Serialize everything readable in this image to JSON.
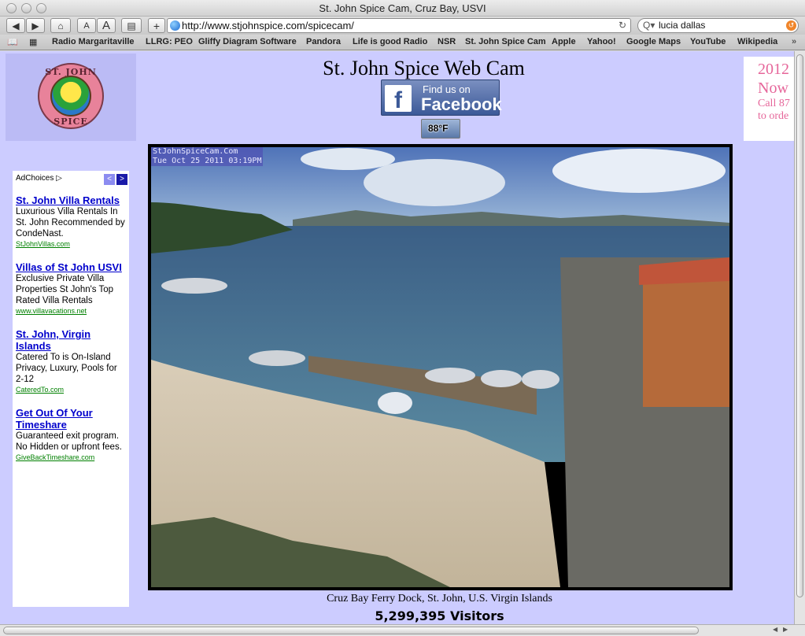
{
  "window": {
    "title": "St. John Spice Cam, Cruz Bay, USVI"
  },
  "toolbar": {
    "back_icon": "back-arrow-icon",
    "forward_icon": "forward-arrow-icon",
    "home_icon": "home-icon",
    "text_smaller": "A",
    "text_bigger": "A",
    "print_icon": "print-icon",
    "add_icon": "+",
    "url": "http://www.stjohnspice.com/spicecam/",
    "reload_glyph": "↻",
    "search_value": "lucia dallas",
    "search_glyph": "Q▾"
  },
  "bookmarks": {
    "book_icon": "📖",
    "grid_icon": "▦",
    "items": [
      "Radio Margaritaville",
      "LLRG: PEO",
      "Gliffy Diagram Software",
      "Pandora",
      "Life is good Radio",
      "NSR",
      "St. John Spice Cam",
      "Apple",
      "Yahoo!",
      "Google Maps",
      "YouTube",
      "Wikipedia"
    ],
    "overflow": "»"
  },
  "logo": {
    "top": "ST. JOHN",
    "bottom": "SPICE"
  },
  "page": {
    "title": "St. John Spice Web Cam",
    "facebook": {
      "small": "Find us on",
      "big": "Facebook",
      "f": "f"
    },
    "weather": "88°F",
    "promo": {
      "l1": "2012",
      "l2": "Now",
      "l3": "Call 87",
      "l4": "to orde"
    },
    "caption": "Cruz Bay Ferry Dock, St. John, U.S. Virgin Islands",
    "visitors": "5,299,395 Visitors"
  },
  "ads": {
    "adchoices": "AdChoices ▷",
    "prev": "<",
    "next": ">",
    "items": [
      {
        "title": "St. John Villa Rentals",
        "body": "Luxurious Villa Rentals In St. John Recommended by CondeNast.",
        "url": "StJohnVillas.com"
      },
      {
        "title": "Villas of St John USVI",
        "body": "Exclusive Private Villa Properties St John's Top Rated Villa Rentals",
        "url": "www.villavacations.net"
      },
      {
        "title": "St. John, Virgin Islands",
        "body": "Catered To is On-Island Privacy, Luxury, Pools for 2-12",
        "url": "CateredTo.com"
      },
      {
        "title": "Get Out Of Your Timeshare",
        "body": "Guaranteed exit program. No Hidden or upfront fees.",
        "url": "GiveBackTimeshare.com"
      }
    ]
  },
  "cam": {
    "stamp_line1": "StJohnSpiceCam.Com",
    "stamp_line2": "Tue Oct 25 2011 03:19PM"
  },
  "colors": {
    "page_bg": "#ccccff",
    "link": "#0000cc",
    "ad_url": "#008000",
    "promo": "#e6669a",
    "facebook": "#3b5998"
  }
}
